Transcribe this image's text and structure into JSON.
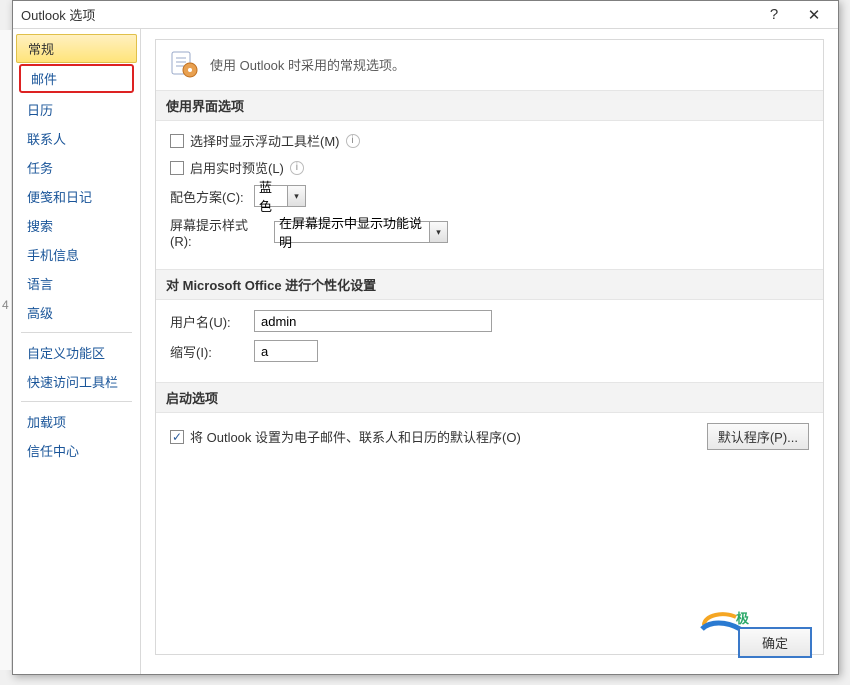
{
  "titlebar": {
    "title": "Outlook 选项",
    "help_tip": "?",
    "close_tip": "✕"
  },
  "sidebar": {
    "items": [
      {
        "label": "常规",
        "selected": true
      },
      {
        "label": "邮件",
        "highlighted": true
      },
      {
        "label": "日历"
      },
      {
        "label": "联系人"
      },
      {
        "label": "任务"
      },
      {
        "label": "便笺和日记"
      },
      {
        "label": "搜索"
      },
      {
        "label": "手机信息"
      },
      {
        "label": "语言"
      },
      {
        "label": "高级"
      }
    ],
    "group2": [
      {
        "label": "自定义功能区"
      },
      {
        "label": "快速访问工具栏"
      }
    ],
    "group3": [
      {
        "label": "加载项"
      },
      {
        "label": "信任中心"
      }
    ]
  },
  "header": {
    "text": "使用 Outlook 时采用的常规选项。"
  },
  "section_ui": {
    "title": "使用界面选项",
    "mini_toolbar": "选择时显示浮动工具栏(M)",
    "live_preview": "启用实时预览(L)",
    "color_scheme_label": "配色方案(C):",
    "color_scheme_value": "蓝色",
    "screentip_label": "屏幕提示样式(R):",
    "screentip_value": "在屏幕提示中显示功能说明"
  },
  "section_pers": {
    "title": "对 Microsoft Office 进行个性化设置",
    "username_label": "用户名(U):",
    "username_value": "admin",
    "initials_label": "缩写(I):",
    "initials_value": "a"
  },
  "section_start": {
    "title": "启动选项",
    "default_check_label": "将 Outlook 设置为电子邮件、联系人和日历的默认程序(O)",
    "default_button": "默认程序(P)..."
  },
  "footer": {
    "ok": "确定"
  }
}
